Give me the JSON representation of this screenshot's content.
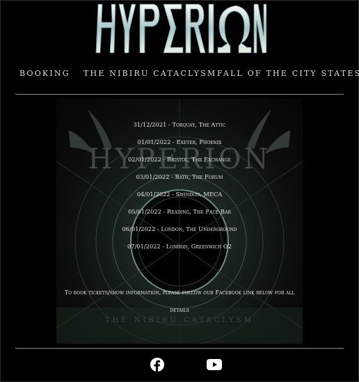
{
  "header": {
    "logo_text": "HYPERION"
  },
  "nav": {
    "items": [
      {
        "label": "BOOKING"
      },
      {
        "label": "THE NIBIRU CATACLYSM"
      },
      {
        "label": "FALL OF THE CITY STATES"
      }
    ]
  },
  "gigs": {
    "dates": [
      "31/12/2021 - Torquay, The Attic",
      "01/01/2022 - Exeter, Phoenix",
      "02/01/2022 - Bristol, The Exchange",
      "03/01/2022 - Bath, The Forum",
      "04/01/2022 - Swindon, MECA",
      "05/01/2022 - Reading, The Face Bar",
      "06/01/2022 - London, The Underground",
      "07/01/2022 - London, Greenwich O2"
    ],
    "info_line1": "To book tickets/show information, please follow our Facebook link below for all",
    "info_line2": "details",
    "poster_title": "THE NIBIRU CATACLYSM",
    "poster_logo": "HYPERION"
  },
  "footer": {
    "facebook_icon": "facebook-icon",
    "youtube_icon": "youtube-icon"
  },
  "colors": {
    "background": "#000000",
    "text": "#e6e6e6",
    "rule": "#8a8a8a"
  }
}
